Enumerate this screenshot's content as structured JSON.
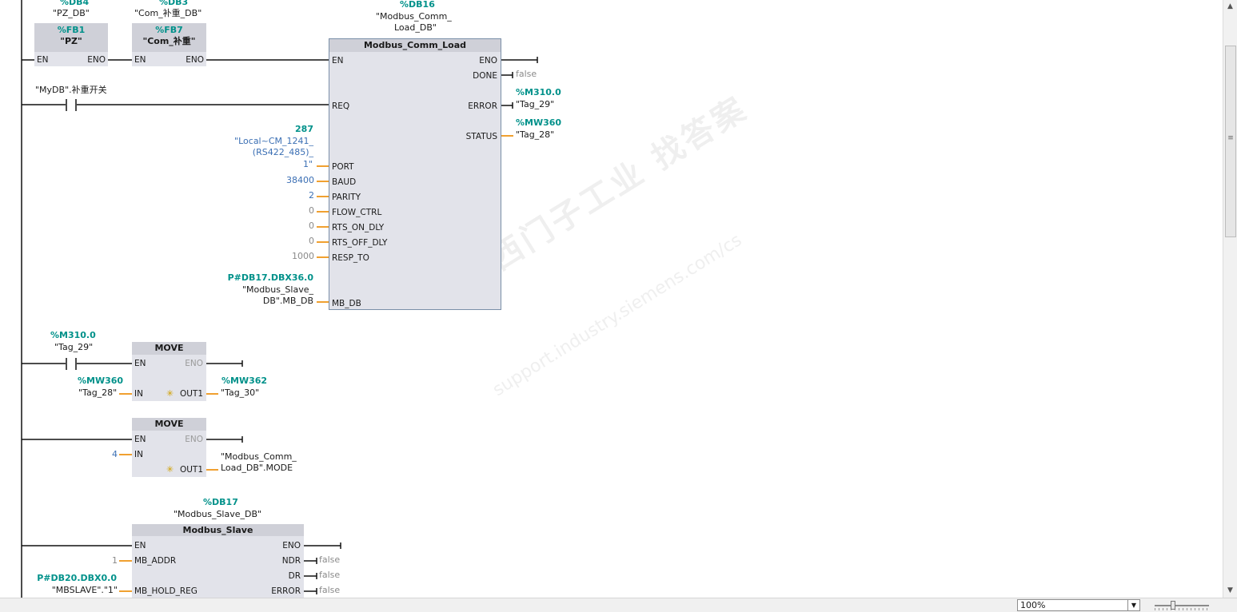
{
  "colors": {
    "rail": "#111111",
    "param_line": "#f0a030",
    "block_fill": "#e2e3ea",
    "block_header": "#cfd0d8",
    "db_teal": "#00918a",
    "value_blue": "#3b6fb4"
  },
  "net1": {
    "fb1": {
      "db_addr": "%DB4",
      "db_name": "\"PZ_DB\"",
      "addr": "%FB1",
      "name": "\"PZ\"",
      "en": "EN",
      "eno": "ENO"
    },
    "fb7": {
      "db_addr": "%DB3",
      "db_name": "\"Com_补重_DB\"",
      "addr": "%FB7",
      "name": "\"Com_补重\"",
      "en": "EN",
      "eno": "ENO"
    },
    "contact_label": "\"MyDB\".补重开关",
    "load": {
      "db_addr": "%DB16",
      "db_name_1": "\"Modbus_Comm_",
      "db_name_2": "Load_DB\"",
      "title": "Modbus_Comm_Load",
      "in_pins": [
        "EN",
        "REQ",
        "PORT",
        "BAUD",
        "PARITY",
        "FLOW_CTRL",
        "RTS_ON_DLY",
        "RTS_OFF_DLY",
        "RESP_TO",
        "MB_DB"
      ],
      "out_pins": [
        "ENO",
        "DONE",
        "ERROR",
        "STATUS"
      ],
      "port_val": "287",
      "port_name_1": "\"Local~CM_1241_",
      "port_name_2": "(RS422_485)_",
      "port_name_3": "1\"",
      "baud": "38400",
      "parity": "2",
      "flow": "0",
      "rts_on": "0",
      "rts_off": "0",
      "resp_to": "1000",
      "mbdb_addr": "P#DB17.DBX36.0",
      "mbdb_name_1": "\"Modbus_Slave_",
      "mbdb_name_2": "DB\".MB_DB",
      "done_val": "false",
      "error_addr": "%M310.0",
      "error_tag": "\"Tag_29\"",
      "status_addr": "%MW360",
      "status_tag": "\"Tag_28\""
    }
  },
  "net2": {
    "contact_addr": "%M310.0",
    "contact_tag": "\"Tag_29\"",
    "title": "MOVE",
    "en": "EN",
    "eno": "ENO",
    "in": "IN",
    "out": "OUT1",
    "in_addr": "%MW360",
    "in_tag": "\"Tag_28\"",
    "out_addr": "%MW362",
    "out_tag": "\"Tag_30\""
  },
  "net3": {
    "title": "MOVE",
    "en": "EN",
    "eno": "ENO",
    "in": "IN",
    "out": "OUT1",
    "in_val": "4",
    "out_tag_1": "\"Modbus_Comm_",
    "out_tag_2": "Load_DB\".MODE"
  },
  "net4": {
    "db_addr": "%DB17",
    "db_name": "\"Modbus_Slave_DB\"",
    "title": "Modbus_Slave",
    "in_pins": [
      "EN",
      "MB_ADDR",
      "MB_HOLD_REG"
    ],
    "out_pins": [
      "ENO",
      "NDR",
      "DR",
      "ERROR"
    ],
    "addr_val": "1",
    "hold_addr": "P#DB20.DBX0.0",
    "hold_tag": "\"MBSLAVE\".\"1\"",
    "ndr_val": "false",
    "dr_val": "false",
    "error_val": "false"
  },
  "watermark": {
    "line1": "西门子工业   找答案",
    "line2": "support.industry.siemens.com/cs"
  },
  "zoom": {
    "value": "100%"
  }
}
